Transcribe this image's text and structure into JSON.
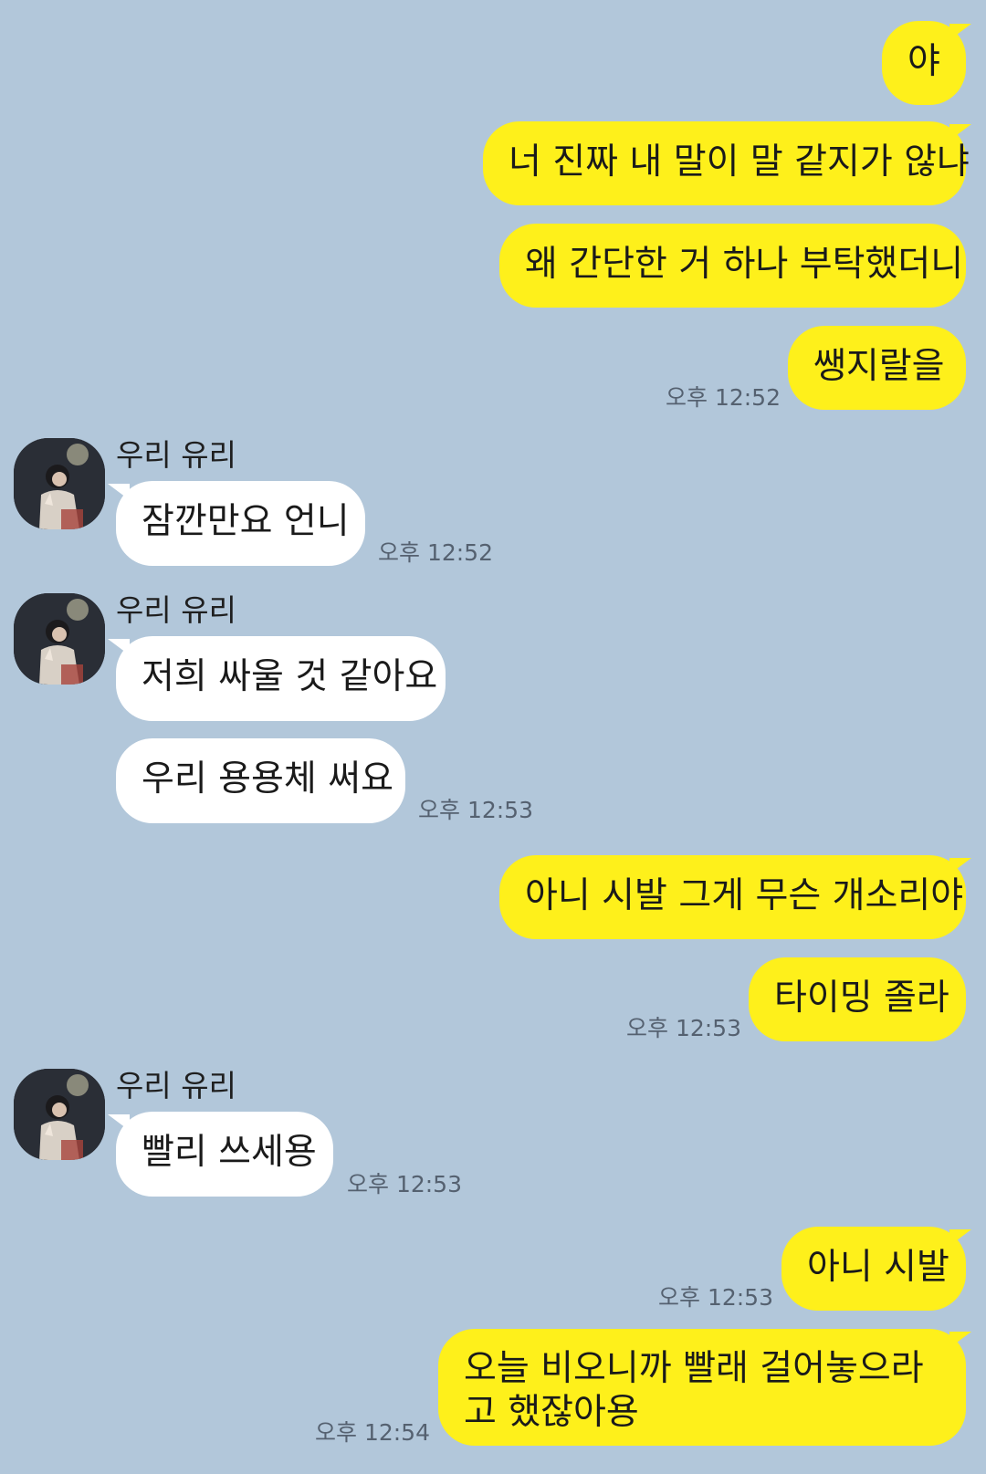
{
  "contact": {
    "name": "우리 유리"
  },
  "messages": {
    "m1": "야",
    "m2": "너 진짜 내 말이 말 같지가 않냐",
    "m3": "왜 간단한 거 하나 부탁했더니",
    "m4": "쌩지랄을",
    "m5": "잠깐만요 언니",
    "m6": "저희 싸울 것 같아요",
    "m7": "우리 용용체 써요",
    "m8": "아니 시발 그게 무슨 개소리야",
    "m9": "타이밍 졸라",
    "m10": "빨리 쓰세용",
    "m11": "아니 시발",
    "m12": "오늘 비오니까 빨래 걸어놓으라고 했잖아용"
  },
  "times": {
    "t1": "오후 12:52",
    "t2": "오후 12:52",
    "t3": "오후 12:53",
    "t4": "오후 12:53",
    "t5": "오후 12:53",
    "t6": "오후 12:53",
    "t7": "오후 12:54"
  },
  "colors": {
    "background": "#b2c7da",
    "my_bubble": "#fef01b",
    "their_bubble": "#ffffff"
  }
}
